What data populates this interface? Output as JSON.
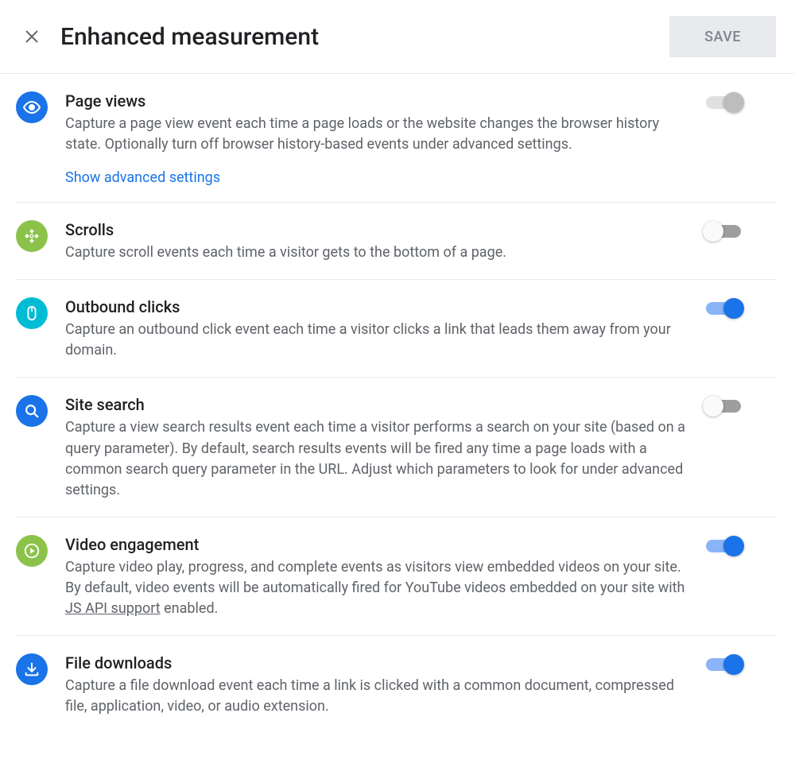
{
  "header": {
    "title": "Enhanced measurement",
    "save_label": "SAVE"
  },
  "items": [
    {
      "id": "page-views",
      "icon": "eye",
      "icon_color": "blue",
      "title": "Page views",
      "desc": "Capture a page view event each time a page loads or the website changes the browser history state. Optionally turn off browser history-based events under advanced settings.",
      "link": "Show advanced settings",
      "toggle_state": "disabled"
    },
    {
      "id": "scrolls",
      "icon": "scrolls",
      "icon_color": "green",
      "title": "Scrolls",
      "desc": "Capture scroll events each time a visitor gets to the bottom of a page.",
      "toggle_state": "off"
    },
    {
      "id": "outbound-clicks",
      "icon": "mouse",
      "icon_color": "cyan",
      "title": "Outbound clicks",
      "desc": "Capture an outbound click event each time a visitor clicks a link that leads them away from your domain.",
      "toggle_state": "on"
    },
    {
      "id": "site-search",
      "icon": "search",
      "icon_color": "blue",
      "title": "Site search",
      "desc": "Capture a view search results event each time a visitor performs a search on your site (based on a query parameter). By default, search results events will be fired any time a page loads with a common search query parameter in the URL. Adjust which parameters to look for under advanced settings.",
      "toggle_state": "off"
    },
    {
      "id": "video-engagement",
      "icon": "play",
      "icon_color": "green",
      "title": "Video engagement",
      "desc_pre": "Capture video play, progress, and complete events as visitors view embedded videos on your site. By default, video events will be automatically fired for YouTube videos embedded on your site with ",
      "desc_underline": "JS API support",
      "desc_post": " enabled.",
      "toggle_state": "on"
    },
    {
      "id": "file-downloads",
      "icon": "download",
      "icon_color": "blue",
      "title": "File downloads",
      "desc": "Capture a file download event each time a link is clicked with a common document, compressed file, application, video, or audio extension.",
      "toggle_state": "on"
    }
  ]
}
